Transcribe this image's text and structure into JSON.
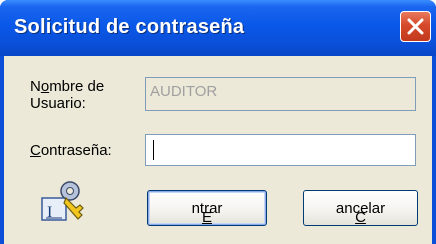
{
  "window": {
    "title": "Solicitud de contraseña"
  },
  "form": {
    "username_label_line1": "Nombre de",
    "username_label_line2": "Usuario:",
    "username_value": "AUDITOR",
    "password_label": "Contraseña:",
    "password_value": ""
  },
  "buttons": {
    "ok_label": "Entrar",
    "cancel_label": "Cancelar"
  },
  "icons": {
    "close": "close-icon",
    "login": "password-key-icon"
  },
  "colors": {
    "titlebar": "#0a58e8",
    "dialog_background": "#ece9d8",
    "close_button": "#d6492b"
  }
}
